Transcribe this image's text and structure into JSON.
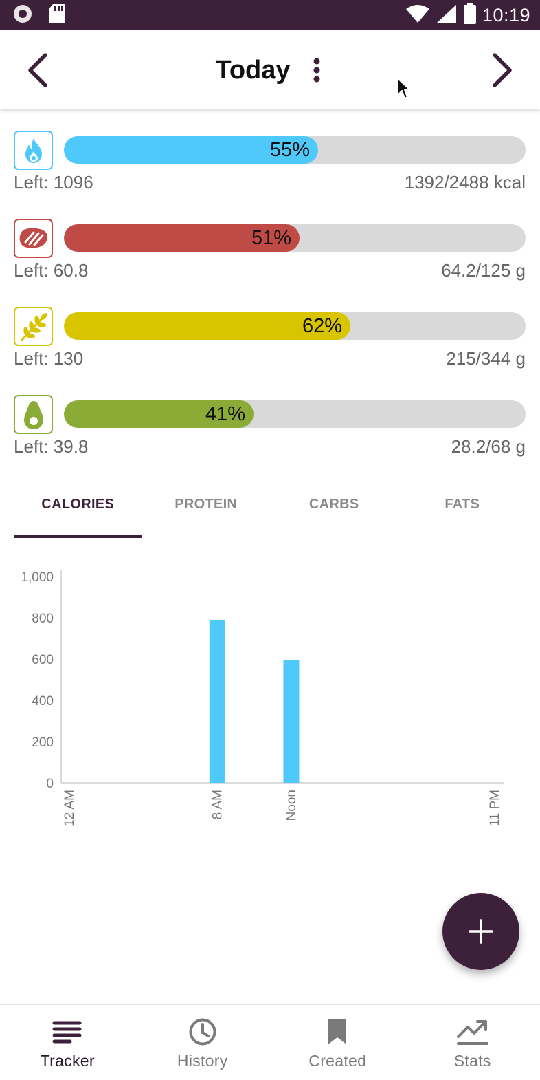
{
  "status_bar": {
    "time": "10:19",
    "icons": [
      "record-icon",
      "sd-card-icon",
      "wifi-icon",
      "cell-signal-icon",
      "battery-icon"
    ]
  },
  "header": {
    "title": "Today",
    "prev_icon": "chevron-left-icon",
    "next_icon": "chevron-right-icon",
    "more_icon": "more-vertical-icon"
  },
  "macros": [
    {
      "key": "calories",
      "icon": "flame-icon",
      "color": "#4fc8fa",
      "progress": 0.55,
      "percent_label": "55%",
      "left_label": "Left: 1096",
      "total_label": "1392/2488 kcal"
    },
    {
      "key": "protein",
      "icon": "steak-icon",
      "color": "#c04a46",
      "progress": 0.51,
      "percent_label": "51%",
      "left_label": "Left: 60.8",
      "total_label": "64.2/125 g"
    },
    {
      "key": "carbs",
      "icon": "wheat-icon",
      "color": "#d9c400",
      "progress": 0.62,
      "percent_label": "62%",
      "left_label": "Left: 130",
      "total_label": "215/344 g"
    },
    {
      "key": "fats",
      "icon": "avocado-icon",
      "color": "#8aab35",
      "progress": 0.41,
      "percent_label": "41%",
      "left_label": "Left: 39.8",
      "total_label": "28.2/68 g"
    }
  ],
  "tabs": [
    {
      "label": "CALORIES",
      "active": true
    },
    {
      "label": "PROTEIN",
      "active": false
    },
    {
      "label": "CARBS",
      "active": false
    },
    {
      "label": "FATS",
      "active": false
    }
  ],
  "chart_data": {
    "type": "bar",
    "x_unit": "hour",
    "x_range": [
      0,
      23
    ],
    "xticks": [
      {
        "hour": 0,
        "label": "12 AM"
      },
      {
        "hour": 8,
        "label": "8 AM"
      },
      {
        "hour": 12,
        "label": "Noon"
      },
      {
        "hour": 23,
        "label": "11 PM"
      }
    ],
    "bars": [
      {
        "hour": 8,
        "value": 790
      },
      {
        "hour": 12,
        "value": 595
      }
    ],
    "ylim": [
      0,
      1000
    ],
    "yticks": [
      {
        "value": 0,
        "label": "0"
      },
      {
        "value": 200,
        "label": "200"
      },
      {
        "value": 400,
        "label": "400"
      },
      {
        "value": 600,
        "label": "600"
      },
      {
        "value": 800,
        "label": "800"
      },
      {
        "value": 1000,
        "label": "1,000"
      }
    ],
    "bar_color": "#4fc8fa",
    "grid": false
  },
  "fab": {
    "icon": "plus-icon"
  },
  "bottom_nav": [
    {
      "label": "Tracker",
      "icon": "tracker-icon",
      "active": true
    },
    {
      "label": "History",
      "icon": "clock-icon",
      "active": false
    },
    {
      "label": "Created",
      "icon": "bookmark-icon",
      "active": false
    },
    {
      "label": "Stats",
      "icon": "trending-up-icon",
      "active": false
    }
  ]
}
